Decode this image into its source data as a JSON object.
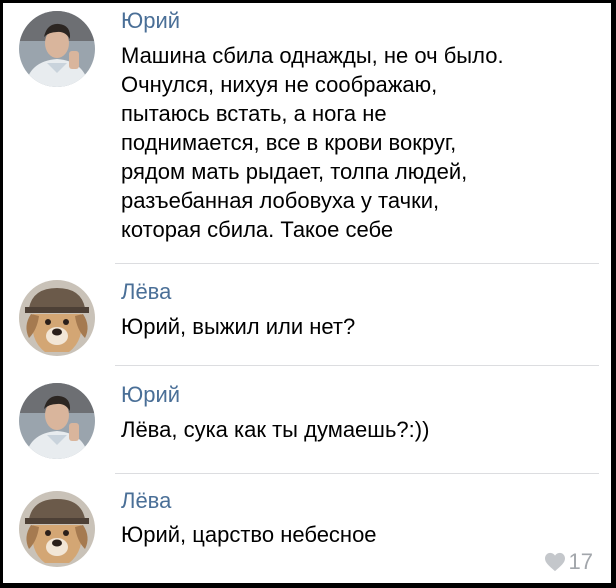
{
  "messages": [
    {
      "author": "Юрий",
      "avatar": "man-avatar",
      "text": "Машина сбила однажды, не оч было.\nОчнулся, нихуя не соображаю,\nпытаюсь встать, а нога не\nподнимается, все в крови вокруг,\nрядом мать рыдает, толпа людей,\nразъебанная лобовуха у тачки,\nкоторая сбила. Такое себе"
    },
    {
      "author": "Лёва",
      "avatar": "dog-avatar",
      "text": "Юрий, выжил или нет?"
    },
    {
      "author": "Юрий",
      "avatar": "man-avatar",
      "text": "Лёва, сука как ты думаешь?:))"
    },
    {
      "author": "Лёва",
      "avatar": "dog-avatar",
      "text": "Юрий, царство небесное"
    }
  ],
  "likes": {
    "icon": "heart-icon",
    "count": "17"
  },
  "colors": {
    "author": "#4a6f97",
    "text": "#000000",
    "divider": "#dcdde0",
    "likes": "#a2a6ab"
  }
}
